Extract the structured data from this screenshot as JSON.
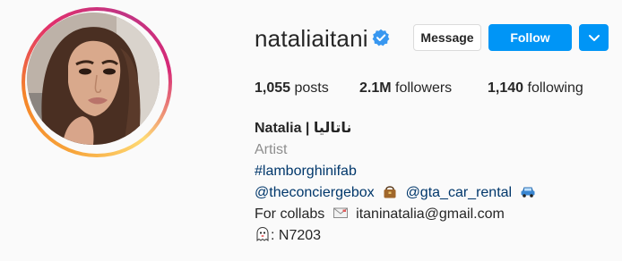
{
  "profile": {
    "username": "nataliaitani",
    "verified": true,
    "avatar_alt": "profile picture"
  },
  "actions": {
    "message_label": "Message",
    "follow_label": "Follow",
    "more_icon": "chevron-down-icon"
  },
  "stats": {
    "posts_count": "1,055",
    "posts_label": "posts",
    "followers_count": "2.1M",
    "followers_label": "followers",
    "following_count": "1,140",
    "following_label": "following"
  },
  "bio": {
    "full_name": "Natalia | ناتاليا",
    "category": "Artist",
    "hashtag": "#lamborghinifab",
    "mention_1": "@theconciergebox",
    "mention_2": "@gta_car_rental",
    "collabs_prefix": "For collabs",
    "email": "itaninatalia@gmail.com",
    "snap_code": ": N7203"
  },
  "colors": {
    "follow_button": "#0095f6",
    "link": "#00376b",
    "muted": "#8e8e8e",
    "verified_badge": "#3897f0"
  }
}
